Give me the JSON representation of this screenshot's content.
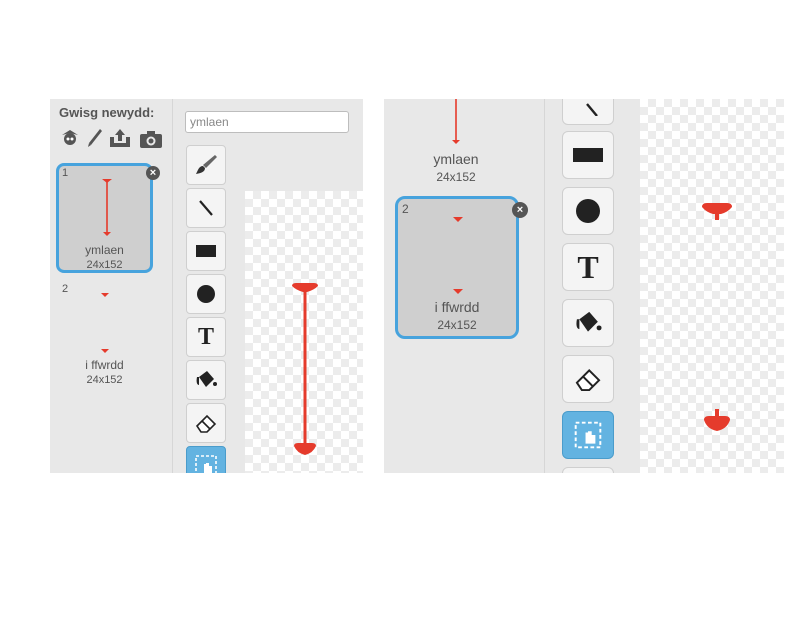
{
  "left_panel": {
    "new_costume_label": "Gwisg newydd:",
    "new_costume_icons": [
      "sprite-library-icon",
      "paint-brush-icon",
      "upload-icon",
      "camera-icon"
    ],
    "name_input_value": "ymlaen",
    "costumes": [
      {
        "number": "1",
        "name": "ymlaen",
        "size": "24x152",
        "selected": true,
        "delete": "×"
      },
      {
        "number": "2",
        "name": "i ffwrdd",
        "size": "24x152",
        "selected": false
      }
    ]
  },
  "right_panel": {
    "costumes": [
      {
        "name": "ymlaen",
        "size": "24x152",
        "selected": false
      },
      {
        "number": "2",
        "name": "i ffwrdd",
        "size": "24x152",
        "selected": true,
        "delete": "×"
      }
    ]
  },
  "tools": [
    "brush-tool",
    "line-tool",
    "rectangle-tool",
    "ellipse-tool",
    "text-tool",
    "fill-tool",
    "eraser-tool",
    "select-tool"
  ],
  "text_tool_glyph": "T",
  "colors": {
    "panel_bg": "#e8e8e8",
    "selection_border": "#47a3dd",
    "active_tool": "#63b3e1",
    "costume_red": "#e53b2c"
  }
}
